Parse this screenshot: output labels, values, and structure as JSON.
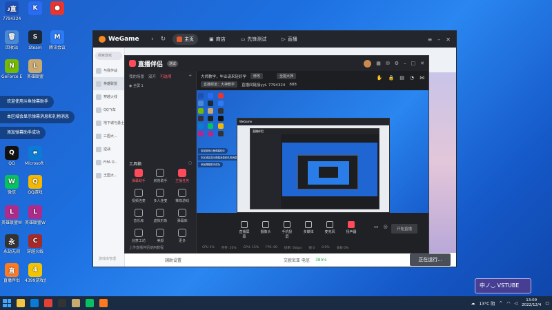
{
  "desktop": {
    "icons": [
      {
        "label": "7794324",
        "top_text": "ᴊ直",
        "color": "#1d4fb4"
      },
      {
        "label": "",
        "top_text": "K",
        "color": "#2a6bf5"
      },
      {
        "label": "",
        "top_text": "●",
        "color": "#e8352f"
      },
      {
        "label": "回收站",
        "top_text": "🗑",
        "color": "#4a89d6"
      },
      {
        "label": "Steam",
        "top_text": "S",
        "color": "#1b2838"
      },
      {
        "label": "腾讯会议",
        "top_text": "M",
        "color": "#2d7bf4"
      },
      {
        "label": "GeForce Experience",
        "top_text": "N",
        "color": "#76b900"
      },
      {
        "label": "英雄联盟",
        "top_text": "L",
        "color": "#c8aa6e"
      },
      {
        "label": "",
        "top_text": "",
        "color": "#333"
      },
      {
        "label": "",
        "top_text": "",
        "color": "#333"
      },
      {
        "label": "WeGame",
        "top_text": "G",
        "color": "#222"
      },
      {
        "label": "QQ",
        "top_text": "Q",
        "color": "#111"
      },
      {
        "label": "Microsoft Edge",
        "top_text": "e",
        "color": "#0c7bd6"
      },
      {
        "label": "微信",
        "top_text": "W",
        "color": "#07c160"
      },
      {
        "label": "QQ游戏",
        "top_text": "Q",
        "color": "#f5b700"
      },
      {
        "label": "英雄联盟WeGame版",
        "top_text": "L",
        "color": "#b02a8c"
      },
      {
        "label": "英雄联盟WeGame版",
        "top_text": "L",
        "color": "#b02a8c"
      },
      {
        "label": "永劫无间",
        "top_text": "永",
        "color": "#333"
      },
      {
        "label": "穿越火线",
        "top_text": "C",
        "color": "#a52a2a"
      },
      {
        "label": "直播伴侣",
        "top_text": "直",
        "color": "#ff7a1f"
      },
      {
        "label": "4399游戏盒",
        "top_text": "4",
        "color": "#f3c300"
      }
    ],
    "toasts": [
      "欢迎使用斗鱼弹幕助手",
      "本区域会显示弹幕消息和礼物消息",
      "添加弹幕助手成功"
    ]
  },
  "wegame": {
    "logo": "WeGame",
    "tabs": [
      {
        "label": "主页",
        "active": true
      },
      {
        "label": "商店",
        "active": false
      },
      {
        "label": "先锋测试",
        "active": false
      },
      {
        "label": "直播",
        "active": false
      }
    ],
    "search_placeholder": "搜索游戏",
    "games": [
      "与我作战",
      "英雄联盟",
      "穿越火线",
      "QQ飞车",
      "地下城与勇士",
      "三国大...",
      "逆战",
      "FIFA O...",
      "王国大..."
    ],
    "selected_game": 1,
    "side_bottom": "游戏库管理",
    "bottom_left": "辅助设置",
    "bottom_mid": "艾欧尼亚 电信",
    "bottom_badge": "38ms",
    "start_label": "正在运行..."
  },
  "zhibo": {
    "logo": "直播伴侣",
    "badge": "测试",
    "left_tabs": [
      "我的场景",
      "双开",
      "可选项"
    ],
    "active_left_tab": 2,
    "scene": "全屏 1",
    "tools_title": "工具箱",
    "tools": [
      {
        "label": "弹幕助手",
        "red": true
      },
      {
        "label": "房管助手",
        "red": false
      },
      {
        "label": "主播任务",
        "red": true
      },
      {
        "label": "视频连麦",
        "red": false
      },
      {
        "label": "多人连麦",
        "red": false
      },
      {
        "label": "推荐游戏",
        "red": false
      },
      {
        "label": "音乐库",
        "red": false
      },
      {
        "label": "虚拟形象",
        "red": false
      },
      {
        "label": "弹幕库",
        "red": false
      },
      {
        "label": "创意工坊",
        "red": false
      },
      {
        "label": "美颜",
        "red": false
      },
      {
        "label": "更多",
        "red": false
      }
    ],
    "left_bottom": "上传直播伴侣使用教程",
    "info": {
      "title": "大师教学，毕业请来轻好学",
      "edit": "修改",
      "category": "全能大神",
      "row2_a": "直播频道：大神教学",
      "row2_b": "直播间链接yyL 7794324",
      "row2_c": "888"
    },
    "controls": [
      {
        "label": "直播屏幕",
        "red": false
      },
      {
        "label": "摄像头",
        "red": false
      },
      {
        "label": "手机投屏",
        "red": false
      },
      {
        "label": "多媒体",
        "red": false
      },
      {
        "label": "麦克风",
        "red": false
      },
      {
        "label": "扬声器",
        "red": true
      }
    ],
    "start_label": "开始直播",
    "status": [
      "CPU 3%",
      "内存: 20%",
      "GPU: 15%",
      "FPS: 60",
      "码率: 0kbps",
      "帧 0",
      "0.0%",
      "丢帧 0%"
    ]
  },
  "widget_text": "中ノ◡ VSTUBE",
  "taskbar": {
    "weather": "13°C 阴",
    "time": "13:09",
    "date": "2022/12/4"
  }
}
